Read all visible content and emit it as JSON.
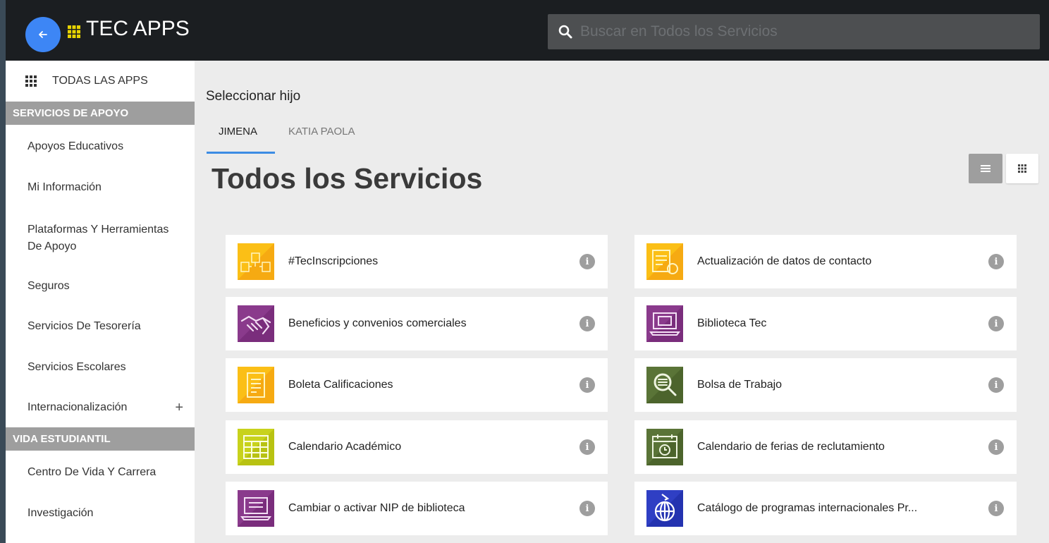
{
  "header": {
    "title": "TEC APPS",
    "search_placeholder": "Buscar en Todos los Servicios"
  },
  "sidebar": {
    "all_apps_label": "TODAS LAS APPS",
    "sections": [
      {
        "title": "SERVICIOS DE APOYO",
        "items": [
          "Apoyos Educativos",
          "Mi Información",
          "Plataformas Y Herramientas De Apoyo",
          "Seguros",
          "Servicios De Tesorería",
          "Servicios Escolares",
          "Internacionalización"
        ]
      },
      {
        "title": "VIDA ESTUDIANTIL",
        "items": [
          "Centro De Vida Y Carrera",
          "Investigación"
        ]
      }
    ],
    "expand_symbol": "+"
  },
  "main": {
    "select_child_label": "Seleccionar hijo",
    "tabs": [
      {
        "label": "JIMENA",
        "active": true
      },
      {
        "label": "KATIA PAOLA",
        "active": false
      }
    ],
    "page_title": "Todos los Servicios",
    "info_symbol": "i",
    "services": [
      {
        "name": "#TecInscripciones",
        "icon": "files-share-icon",
        "color": "#fbbf16"
      },
      {
        "name": "Actualización de datos de contacto",
        "icon": "contact-update-icon",
        "color": "#fbbf16"
      },
      {
        "name": "Beneficios y convenios comerciales",
        "icon": "handshake-icon",
        "color": "#8a3a8c"
      },
      {
        "name": "Biblioteca Tec",
        "icon": "library-laptop-icon",
        "color": "#8a3a8c"
      },
      {
        "name": "Boleta Calificaciones",
        "icon": "report-card-icon",
        "color": "#fbbf16"
      },
      {
        "name": "Bolsa de Trabajo",
        "icon": "job-search-icon",
        "color": "#5a7437"
      },
      {
        "name": "Calendario Académico",
        "icon": "calendar-icon",
        "color": "#c8d21c"
      },
      {
        "name": "Calendario de ferias de reclutamiento",
        "icon": "calendar-clock-icon",
        "color": "#5a7437"
      },
      {
        "name": "Cambiar o activar NIP de biblioteca",
        "icon": "library-pin-icon",
        "color": "#8a3a8c"
      },
      {
        "name": "Catálogo de programas internacionales Pr...",
        "icon": "globe-plane-icon",
        "color": "#2f3fc4"
      }
    ]
  },
  "colors": {
    "accent_blue": "#3d86f5",
    "tab_underline": "#3c8ce4",
    "grid_icon_yellow": "#e8d400"
  }
}
